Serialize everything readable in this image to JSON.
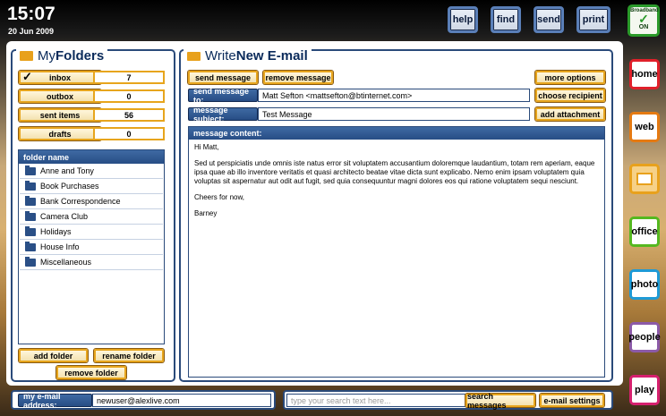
{
  "clock": {
    "time": "15:07",
    "date": "20 Jun 2009"
  },
  "topbar": {
    "help": "help",
    "find": "find",
    "send": "send",
    "print": "print",
    "broadband_label": "Broadband",
    "broadband_status": "ON"
  },
  "side_nav": {
    "home": "home",
    "web": "web",
    "office": "office",
    "photo": "photo",
    "people": "people",
    "play": "play"
  },
  "colors": {
    "home": "#e0202a",
    "web": "#e57a12",
    "email": "#e8a11c",
    "office": "#55b820",
    "photo": "#1e9ad6",
    "people": "#8c5aa8",
    "play": "#d6206e"
  },
  "folders_panel": {
    "title_prefix": "My ",
    "title": "Folders",
    "system_folders": [
      {
        "label": "inbox",
        "count": "7",
        "checked": "✓"
      },
      {
        "label": "outbox",
        "count": "0"
      },
      {
        "label": "sent items",
        "count": "56"
      },
      {
        "label": "drafts",
        "count": "0"
      }
    ],
    "list_header": "folder name",
    "folders": [
      "Anne and Tony",
      "Book Purchases",
      "Bank Correspondence",
      "Camera Club",
      "Holidays",
      "House Info",
      "Miscellaneous"
    ],
    "add_folder": "add folder",
    "rename_folder": "rename folder",
    "remove_folder": "remove folder"
  },
  "compose": {
    "title_prefix": "Write ",
    "title": "New E-mail",
    "send_message": "send message",
    "remove_message": "remove message",
    "more_options": "more options",
    "to_label": "send message to:",
    "to_value": "Matt Sefton <mattsefton@btinternet.com>",
    "choose_recipient": "choose recipient",
    "subject_label": "message subject:",
    "subject_value": "Test Message",
    "add_attachment": "add attachment",
    "content_label": "message content:",
    "body": {
      "greeting": "Hi Matt,",
      "paragraph": "Sed ut perspiciatis unde omnis iste natus error sit voluptatem accusantium doloremque laudantium, totam rem aperiam, eaque ipsa quae ab illo inventore veritatis et quasi architecto beatae vitae dicta sunt explicabo. Nemo enim ipsam voluptatem quia voluptas sit aspernatur aut odit aut fugit, sed quia consequuntur magni dolores eos qui ratione voluptatem sequi nesciunt.",
      "closing": "Cheers for now,",
      "signature": "Barney"
    }
  },
  "bottom": {
    "email_label": "my e-mail address:",
    "email_value": "newuser@alexlive.com",
    "search_placeholder": "type your search text here...",
    "search_messages": "search messages",
    "email_settings": "e-mail settings"
  }
}
